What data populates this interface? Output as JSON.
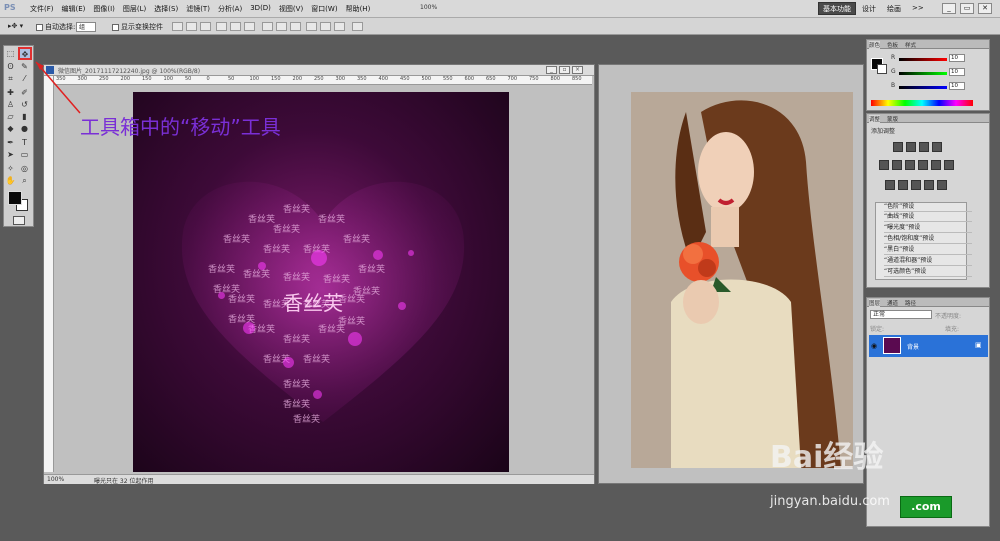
{
  "app": {
    "logo": "PS"
  },
  "menubar": {
    "items": [
      "文件(F)",
      "编辑(E)",
      "图像(I)",
      "图层(L)",
      "选择(S)",
      "滤镜(T)",
      "分析(A)",
      "3D(D)",
      "视图(V)",
      "窗口(W)",
      "帮助(H)"
    ],
    "zoom": "100%",
    "workspace_active": "基本功能",
    "workspace_other": [
      "设计",
      "绘画"
    ],
    "more": ">>"
  },
  "options": {
    "auto_select_label": "自动选择:",
    "auto_select_value": "组",
    "show_transform_label": "显示变换控件"
  },
  "doc1": {
    "title": "微信图片_20171117212240.jpg @ 100%(RGB/8)",
    "ruler_ticks": [
      "350",
      "300",
      "250",
      "200",
      "150",
      "100",
      "50",
      "0",
      "50",
      "100",
      "150",
      "200",
      "250",
      "300",
      "350",
      "400",
      "450",
      "500",
      "550",
      "600",
      "650",
      "700",
      "750",
      "800",
      "850"
    ],
    "heart_text": "香丝芙",
    "status_zoom": "100%",
    "status_text": "曝光只在 32 位起作用"
  },
  "annotation": {
    "text": "工具箱中的“移动”工具"
  },
  "color_panel": {
    "tabs": [
      "颜色",
      "色板",
      "样式"
    ],
    "channels": [
      {
        "label": "R",
        "value": "10"
      },
      {
        "label": "G",
        "value": "10"
      },
      {
        "label": "B",
        "value": "10"
      }
    ]
  },
  "adjust_panel": {
    "tabs": [
      "调整",
      "蒙版"
    ],
    "header": "添加调整",
    "presets": [
      "“色阶”预设",
      "“曲线”预设",
      "“曝光度”预设",
      "“色相/饱和度”预设",
      "“黑白”预设",
      "“通道混和器”预设",
      "“可选颜色”预设"
    ]
  },
  "layers_panel": {
    "tabs": [
      "图层",
      "通道",
      "路径"
    ],
    "blend_mode": "正常",
    "opacity_label": "不透明度:",
    "lock_label": "锁定:",
    "fill_label": "填充:",
    "layer_name": "背景"
  },
  "watermark": {
    "brand": "Bai经验",
    "url": "jingyan.baidu.com",
    "badge": ".com"
  }
}
